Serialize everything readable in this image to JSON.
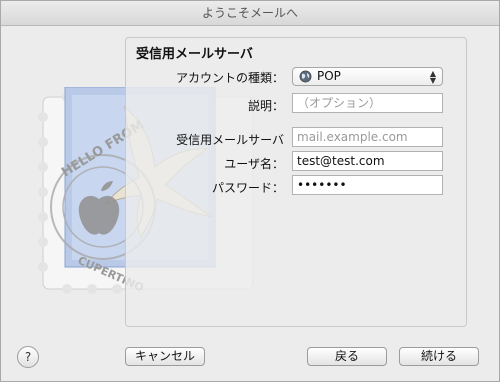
{
  "window": {
    "title": "ようこそメールへ"
  },
  "stamp": {
    "text_top": "HELLO FROM",
    "text_bottom": "CUPERTINO"
  },
  "form": {
    "section_title": "受信用メールサーバ",
    "account_type": {
      "label": "アカウントの種類：",
      "value": "POP"
    },
    "description": {
      "label": "説明：",
      "placeholder": "（オプション）"
    },
    "server": {
      "label": "受信用メールサーバ",
      "placeholder": "mail.example.com"
    },
    "username": {
      "label": "ユーザ名：",
      "value": "test@test.com"
    },
    "password": {
      "label": "パスワード：",
      "value": "•••••••"
    }
  },
  "buttons": {
    "help": "?",
    "cancel": "キャンセル",
    "back": "戻る",
    "continue": "続ける"
  },
  "icons": {
    "globe": "globe-icon",
    "updown": "updown-arrows-icon",
    "stamp": "mail-stamp-icon"
  }
}
